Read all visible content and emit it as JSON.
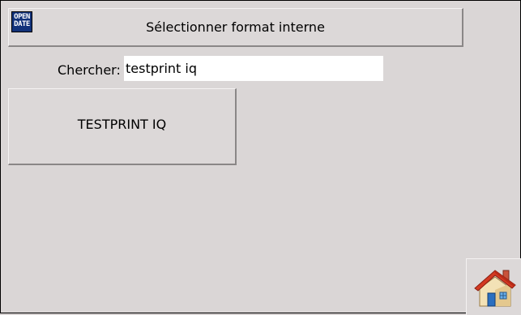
{
  "header": {
    "title": "Sélectionner format interne",
    "logo_line1": "OPEN",
    "logo_line2": "DATE"
  },
  "search": {
    "label": "Chercher:",
    "value": "testprint iq"
  },
  "results": [
    {
      "label": "TESTPRINT IQ"
    }
  ],
  "icons": {
    "logo": "open-date-logo",
    "home": "home-icon"
  }
}
